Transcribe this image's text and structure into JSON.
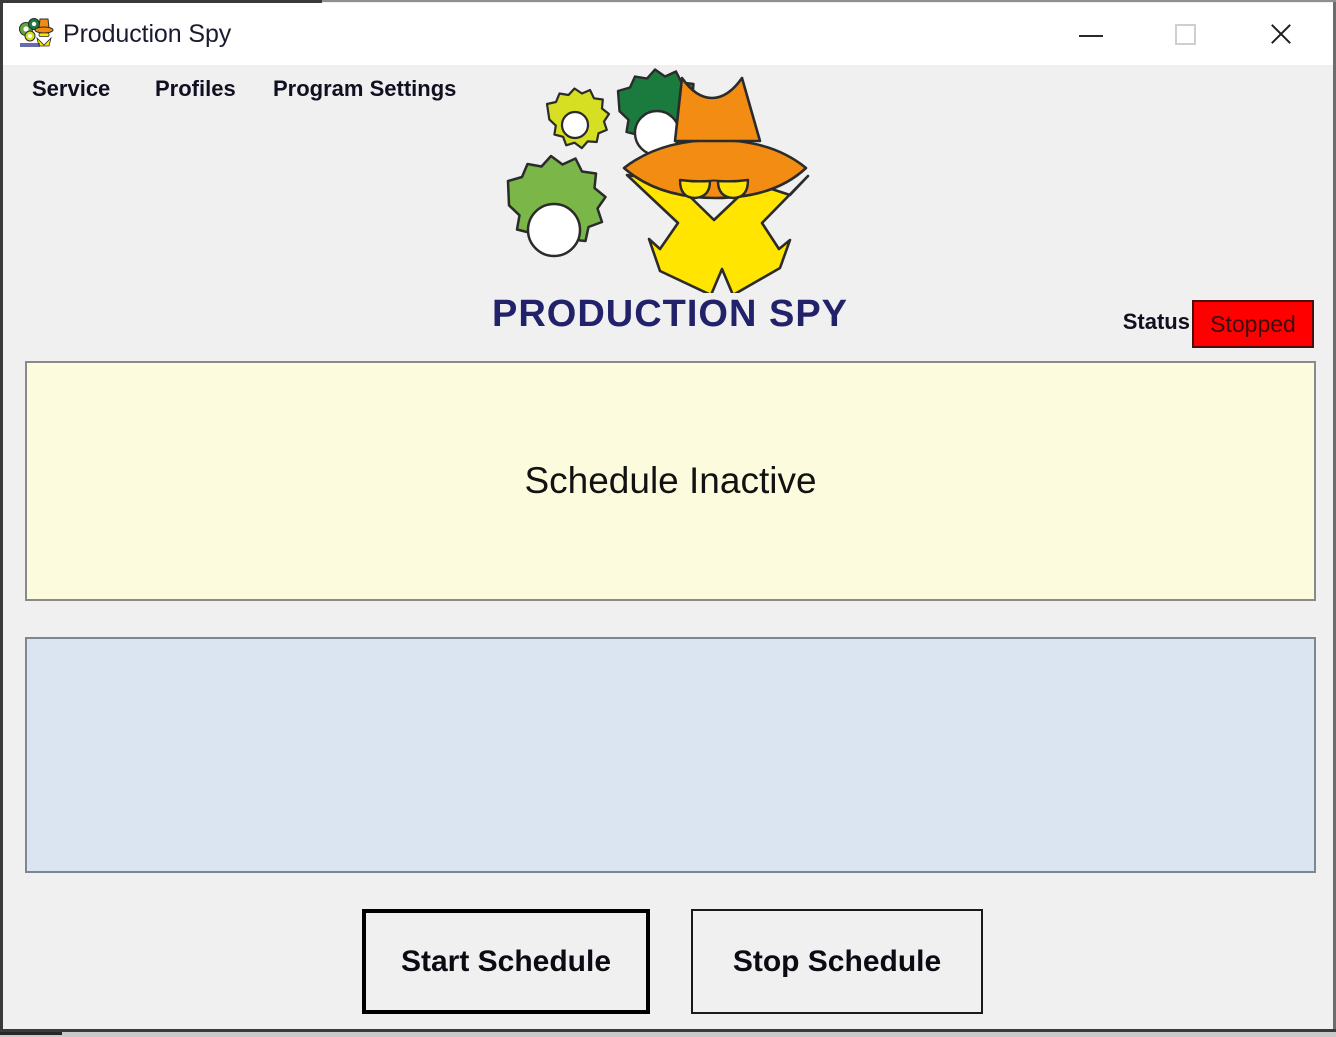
{
  "window": {
    "title": "Production Spy",
    "app_icon": "app-logo-icon",
    "controls": {
      "minimize": "minimize-icon",
      "maximize": "maximize-icon",
      "close": "close-icon"
    }
  },
  "menu": {
    "items": [
      {
        "label": "Service"
      },
      {
        "label": "Profiles"
      },
      {
        "label": "Program Settings"
      }
    ]
  },
  "logo": {
    "wordmark": "PRODUCTION SPY",
    "colors": {
      "hat": "#F28C12",
      "glasses": "#FFE500",
      "collar": "#FFE500",
      "gear_small": "#D7DF23",
      "gear_medium": "#1B7A3D",
      "gear_large": "#7AB648",
      "wordmark": "#22226B"
    }
  },
  "status": {
    "label": "Status",
    "value": "Stopped",
    "color": "#FF0000"
  },
  "schedule_panel": {
    "message": "Schedule Inactive",
    "background": "#FDFBDD"
  },
  "log_panel": {
    "content": "",
    "background": "#DBE5F1"
  },
  "buttons": {
    "start": "Start Schedule",
    "stop": "Stop Schedule"
  }
}
